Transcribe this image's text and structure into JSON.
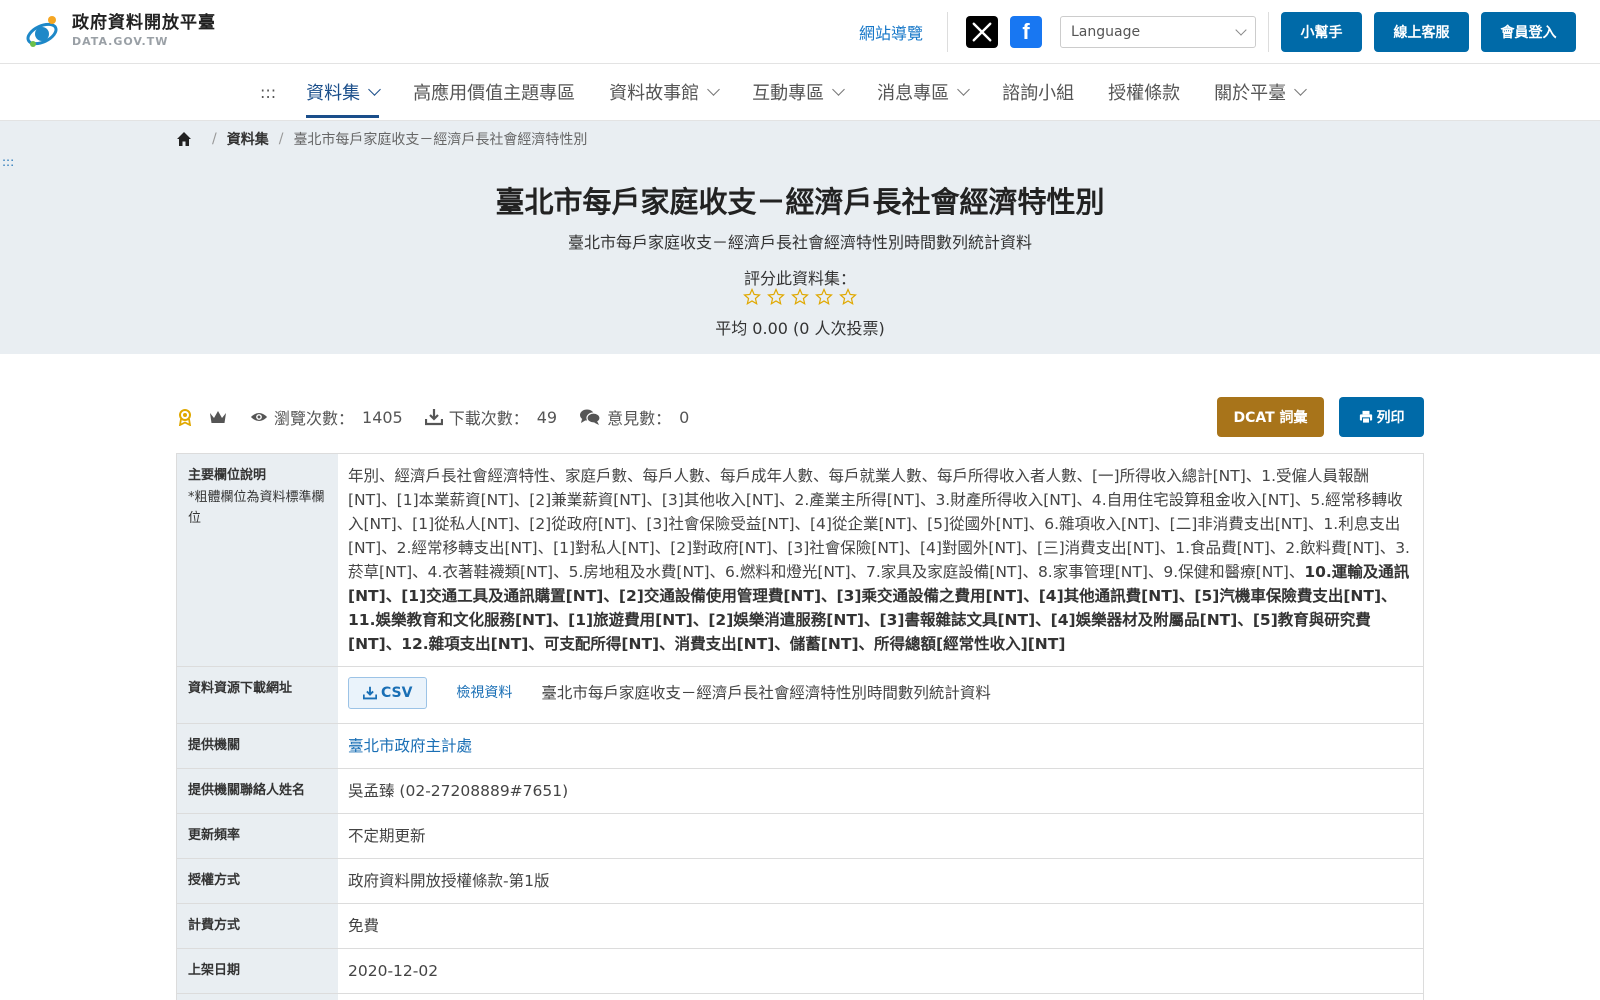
{
  "header": {
    "logo_name": "政府資料開放平臺",
    "logo_sub": "DATA.GOV.TW",
    "site_map": "網站導覽",
    "language_placeholder": "Language",
    "buttons": [
      "小幫手",
      "線上客服",
      "會員登入"
    ]
  },
  "nav": {
    "accesskey": ":::",
    "items": [
      {
        "label": "資料集",
        "caret": true,
        "active": true
      },
      {
        "label": "高應用價值主題專區",
        "caret": false,
        "active": false
      },
      {
        "label": "資料故事館",
        "caret": true,
        "active": false
      },
      {
        "label": "互動專區",
        "caret": true,
        "active": false
      },
      {
        "label": "消息專區",
        "caret": true,
        "active": false
      },
      {
        "label": "諮詢小組",
        "caret": false,
        "active": false
      },
      {
        "label": "授權條款",
        "caret": false,
        "active": false
      },
      {
        "label": "關於平臺",
        "caret": true,
        "active": false
      }
    ]
  },
  "breadcrumb": {
    "section": "資料集",
    "current": "臺北市每戶家庭收支－經濟戶長社會經濟特性別"
  },
  "hero": {
    "accesskey": ":::",
    "title": "臺北市每戶家庭收支－經濟戶長社會經濟特性別",
    "subtitle": "臺北市每戶家庭收支－經濟戶長社會經濟特性別時間數列統計資料",
    "rate_label": "評分此資料集：",
    "rating": 0,
    "avg_text": "平均 0.00 (0 人次投票)"
  },
  "stats": {
    "views_label": "瀏覽次數：",
    "views": "1405",
    "downloads_label": "下載次數：",
    "downloads": "49",
    "comments_label": "意見數：",
    "comments": "0",
    "dcat_label": "DCAT 詞彙",
    "print_label": "列印"
  },
  "table": {
    "fields_header": "主要欄位說明",
    "fields_note": "*粗體欄位為資料標準欄位",
    "fields_normal": "年別、經濟戶長社會經濟特性、家庭戶數、每戶人數、每戶成年人數、每戶就業人數、每戶所得收入者人數、[一]所得收入總計[NT]、1.受僱人員報酬[NT]、[1]本業薪資[NT]、[2]兼業薪資[NT]、[3]其他收入[NT]、2.產業主所得[NT]、3.財產所得收入[NT]、4.自用住宅設算租金收入[NT]、5.經常移轉收入[NT]、[1]從私人[NT]、[2]從政府[NT]、[3]社會保險受益[NT]、[4]從企業[NT]、[5]從國外[NT]、6.雜項收入[NT]、[二]非消費支出[NT]、1.利息支出[NT]、2.經常移轉支出[NT]、[1]對私人[NT]、[2]對政府[NT]、[3]社會保險[NT]、[4]對國外[NT]、[三]消費支出[NT]、1.食品費[NT]、2.飲料費[NT]、3.菸草[NT]、4.衣著鞋襪類[NT]、5.房地租及水費[NT]、6.燃料和燈光[NT]、7.家具及家庭設備[NT]、8.家事管理[NT]、9.保健和醫療[NT]、",
    "fields_bold": "10.運輸及通訊[NT]、[1]交通工具及通訊購置[NT]、[2]交通設備使用管理費[NT]、[3]乘交通設備之費用[NT]、[4]其他通訊費[NT]、[5]汽機車保險費支出[NT]、11.娛樂教育和文化服務[NT]、[1]旅遊費用[NT]、[2]娛樂消遣服務[NT]、[3]書報雜誌文具[NT]、[4]娛樂器材及附屬品[NT]、[5]教育與研究費[NT]、12.雜項支出[NT]、可支配所得[NT]、消費支出[NT]、儲蓄[NT]、所得總額[經常性收入][NT]",
    "download_header": "資料資源下載網址",
    "csv_label": "CSV",
    "view_label": "檢視資料",
    "download_desc": "臺北市每戶家庭收支－經濟戶長社會經濟特性別時間數列統計資料",
    "provider_header": "提供機關",
    "provider": "臺北市政府主計處",
    "contact_header": "提供機關聯絡人姓名",
    "contact": "吳孟臻 (02-27208889#7651)",
    "freq_header": "更新頻率",
    "freq": "不定期更新",
    "license_header": "授權方式",
    "license": "政府資料開放授權條款-第1版",
    "fee_header": "計費方式",
    "fee": "免費",
    "date_header": "上架日期",
    "date": "2020-12-02"
  },
  "colors": {
    "primary": "#006aa8",
    "dcat": "#a8741a",
    "nav_active": "#1a4e8a",
    "hero_bg": "#e9eef2",
    "star": "#e0a800"
  }
}
